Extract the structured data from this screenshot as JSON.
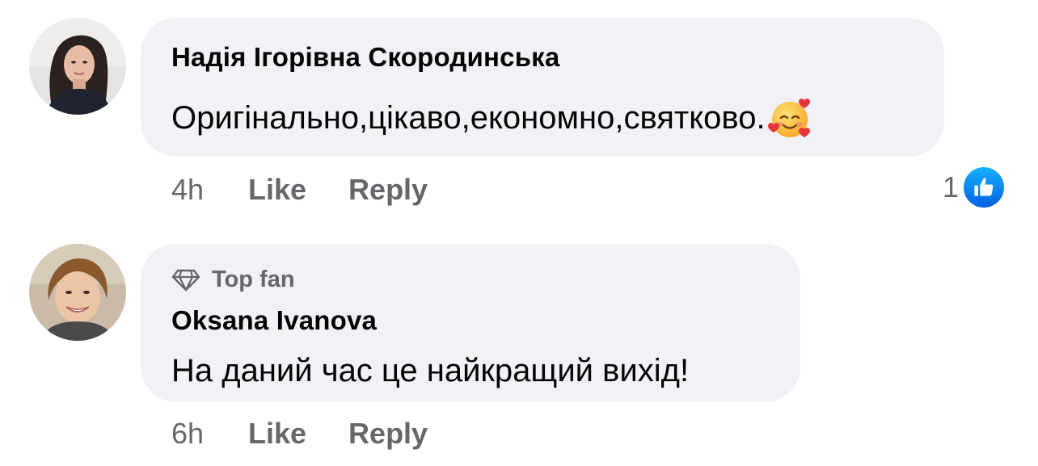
{
  "comments": [
    {
      "author": "Надія Ігорівна Скородинська",
      "text": "Оригінально,цікаво,економно,святково.",
      "emoji": "smiling-face-with-hearts",
      "time": "4h",
      "like_label": "Like",
      "reply_label": "Reply",
      "reaction_count": "1",
      "reaction_type": "like"
    },
    {
      "badge": "Top fan",
      "author": "Oksana Ivanova",
      "text": "На даний час це найкращий вихід!",
      "time": "6h",
      "like_label": "Like",
      "reply_label": "Reply"
    }
  ],
  "colors": {
    "bubble": "#f0f2f5",
    "meta": "#65676b",
    "like_blue": "#0866ff"
  }
}
